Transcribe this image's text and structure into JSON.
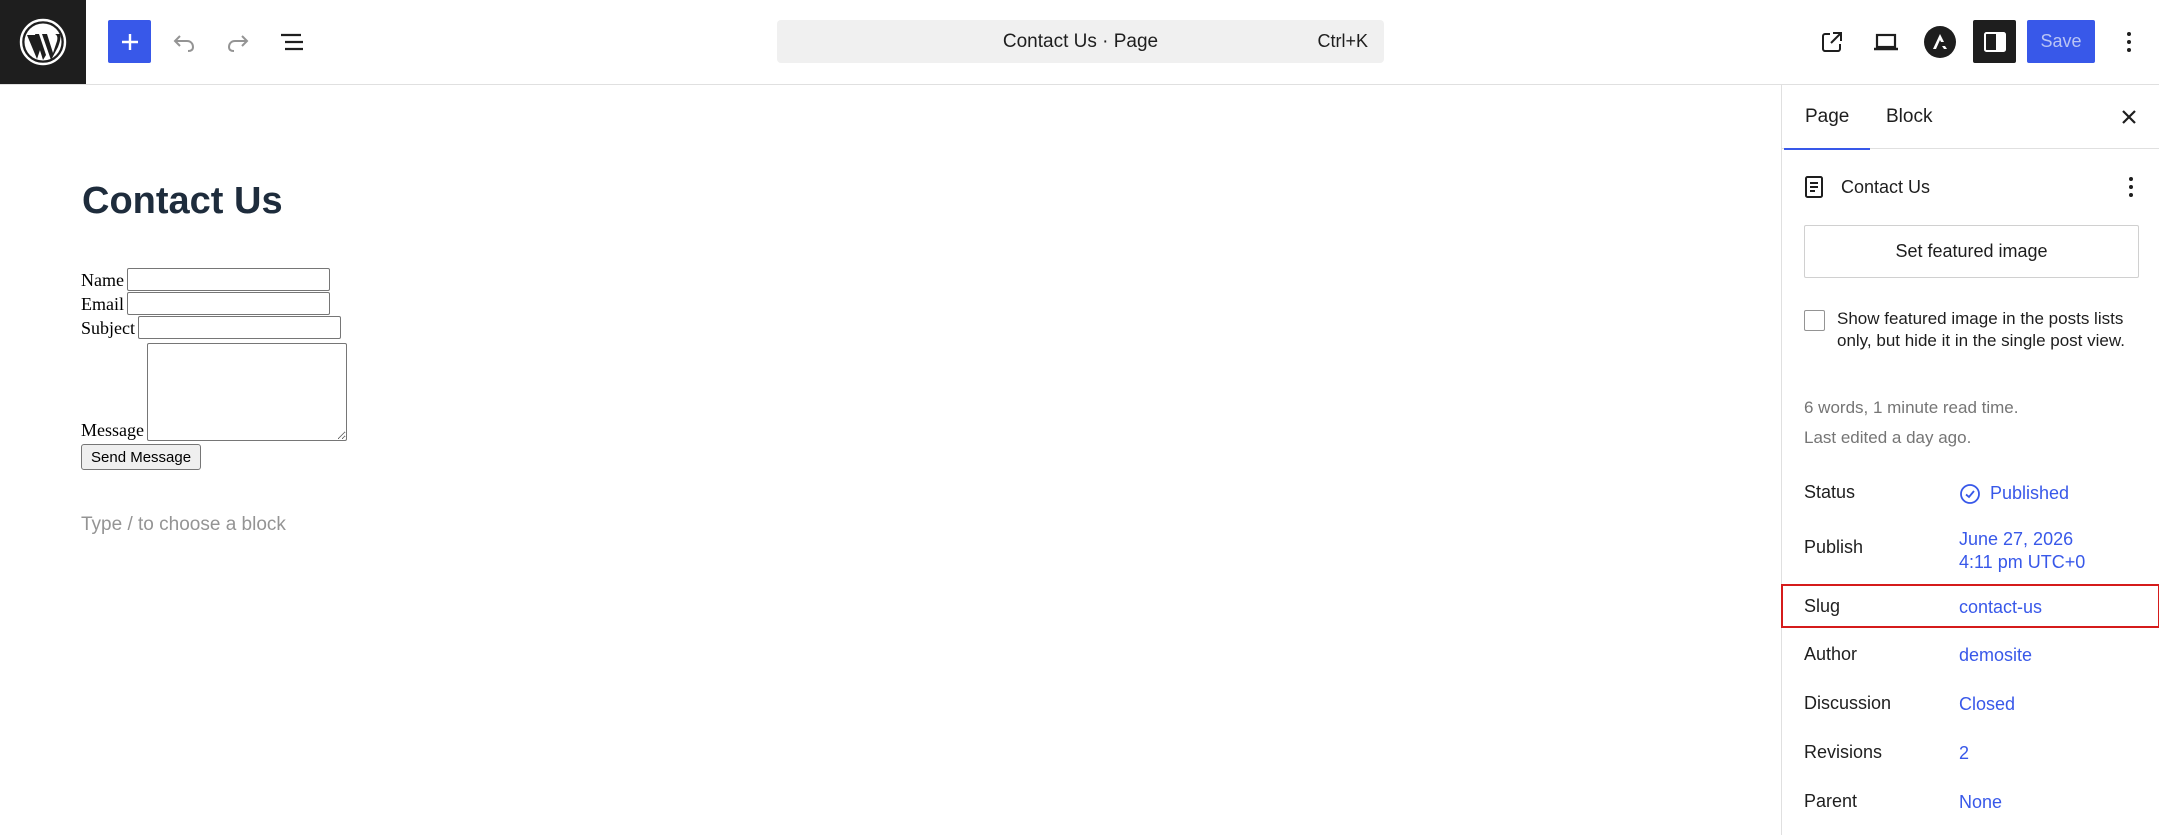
{
  "topbar": {
    "command_title": "Contact Us · Page",
    "command_shortcut": "Ctrl+K",
    "save_label": "Save"
  },
  "icons": {
    "logo": "wordpress-logo-icon",
    "add": "plus-icon",
    "undo": "undo-icon",
    "redo": "redo-icon",
    "list_view": "list-view-icon",
    "view": "external-link-icon",
    "preview": "laptop-icon",
    "astra": "astra-icon",
    "settings": "sidebar-toggle-icon",
    "more": "vertical-ellipsis-icon"
  },
  "canvas": {
    "title": "Contact Us",
    "form": {
      "name_label": "Name",
      "email_label": "Email",
      "subject_label": "Subject",
      "message_label": "Message",
      "submit_label": "Send Message"
    },
    "block_hint": "Type / to choose a block"
  },
  "sidebar": {
    "tabs": [
      {
        "label": "Page",
        "active": true
      },
      {
        "label": "Block",
        "active": false
      }
    ],
    "document_title": "Contact Us",
    "featured_image_button": "Set featured image",
    "featured_checkbox_label": "Show featured image in the posts lists only, but hide it in the single post view.",
    "featured_checkbox_checked": false,
    "word_count": "6 words, 1 minute read time.",
    "last_edited": "Last edited a day ago.",
    "properties": {
      "status": {
        "label": "Status",
        "value": "Published"
      },
      "publish": {
        "label": "Publish",
        "date": "June 27, 2026",
        "time": "4:11 pm UTC+0"
      },
      "slug": {
        "label": "Slug",
        "value": "contact-us"
      },
      "author": {
        "label": "Author",
        "value": "demosite"
      },
      "discussion": {
        "label": "Discussion",
        "value": "Closed"
      },
      "revisions": {
        "label": "Revisions",
        "value": "2"
      },
      "parent": {
        "label": "Parent",
        "value": "None"
      }
    }
  },
  "colors": {
    "accent": "#3858e9",
    "dark": "#1e1e1e",
    "highlight_border": "#d51b1b",
    "muted": "#757575"
  }
}
